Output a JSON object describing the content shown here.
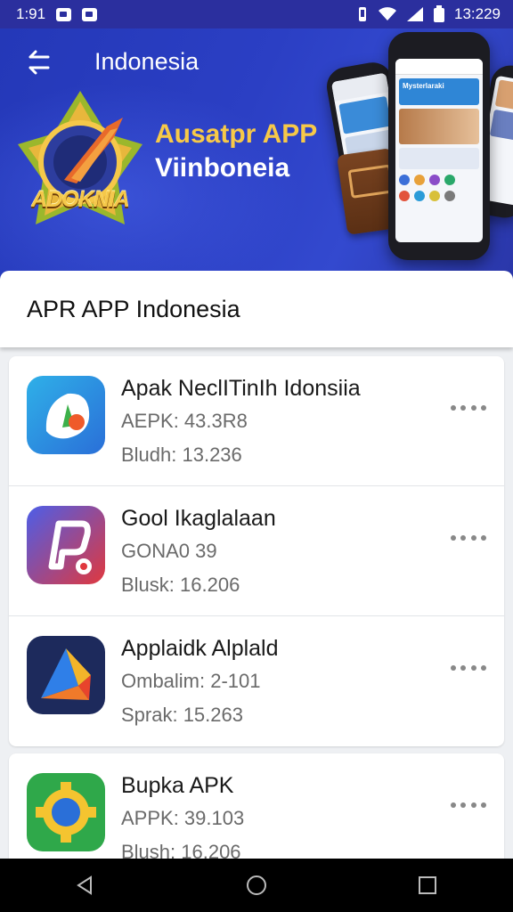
{
  "status_bar": {
    "time_left": "1:91",
    "time_right": "13:229"
  },
  "toolbar": {
    "title": "Indonesia",
    "back_icon": "back-arrow-icon"
  },
  "banner": {
    "logo_text": "ADOKNIA",
    "heading": "Ausatpr APP",
    "subheading": "Viinboneia",
    "phone_screen_label": "Mysterlaraki"
  },
  "section": {
    "title": "APR APP Indonesia"
  },
  "apps": [
    {
      "name": "Apak NeclITinIh Idonsiia",
      "meta1": "AEPK: 43.3R8",
      "meta2": "Bludh: 13.236",
      "icon": "app-icon-green-leaf"
    },
    {
      "name": "Gool Ikaglalaan",
      "meta1": "GONA0 39",
      "meta2": "Blusk: 16.206",
      "icon": "app-icon-p-logo"
    },
    {
      "name": "Applaidk Alplald",
      "meta1": "Ombalim: 2-101",
      "meta2": "Sprak: 15.263",
      "icon": "app-icon-folded-paper"
    },
    {
      "name": "Bupka APK",
      "meta1": "APPK: 39.103",
      "meta2": "Blush: 16.206",
      "icon": "app-icon-gear"
    }
  ],
  "colors": {
    "banner": "#2b3fc4",
    "accent_yellow": "#f7c948"
  }
}
